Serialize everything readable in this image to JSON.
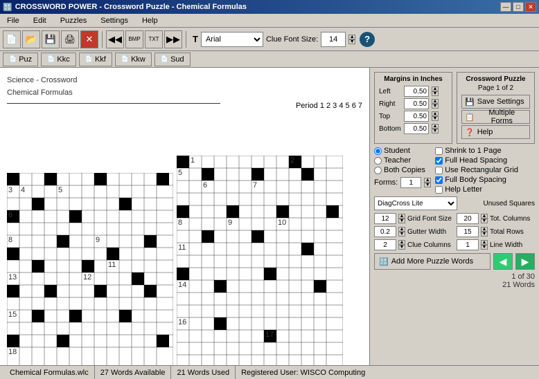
{
  "window": {
    "title": "CROSSWORD POWER - Crossword Puzzle - Chemical Formulas",
    "icon": "🔠"
  },
  "titlebar": {
    "controls": [
      "—",
      "□",
      "✕"
    ]
  },
  "menubar": {
    "items": [
      "File",
      "Edit",
      "Puzzles",
      "Settings",
      "Help"
    ]
  },
  "toolbar": {
    "font_label": "T",
    "font_value": "Arial",
    "clue_font_label": "Clue Font Size:",
    "clue_font_size": "14",
    "help_label": "?"
  },
  "filetabs": {
    "tabs": [
      "Puz",
      "Kkc",
      "Kkf",
      "Kkw",
      "Sud"
    ]
  },
  "puzzle": {
    "title_line1": "Science - Crossword",
    "title_line2": "Chemical Formulas",
    "period_label": "Period",
    "period_values": "1  2  3  4  5  6  7"
  },
  "right_panel": {
    "margins_title": "Margins in Inches",
    "margins": {
      "left_label": "Left",
      "left_value": "0.50",
      "right_label": "Right",
      "right_value": "0.50",
      "top_label": "Top",
      "top_value": "0.50",
      "bottom_label": "Bottom",
      "bottom_value": "0.50"
    },
    "puzzle_info_title": "Crossword Puzzle",
    "puzzle_info_page": "Page 1 of 2",
    "save_settings_label": "Save Settings",
    "multiple_forms_label": "Multiple Forms",
    "help_label": "Help",
    "radio_options": [
      "Student",
      "Teacher",
      "Both Copies"
    ],
    "forms_label": "Forms:",
    "forms_value": "1",
    "checkboxes": {
      "shrink_label": "Shrink to 1 Page",
      "full_head_label": "Full Head Spacing",
      "rectangular_label": "Use Rectangular Grid",
      "full_body_label": "Full Body Spacing",
      "help_letter_label": "Help Letter"
    },
    "shrink_checked": false,
    "full_head_checked": true,
    "rectangular_checked": false,
    "full_body_checked": true,
    "font_style_value": "DiagCross Lite",
    "unused_squares_label": "Unused Squares",
    "grid_font_label": "Grid Font Size",
    "grid_font_value": "12",
    "tot_columns_label": "Tot. Columns",
    "tot_columns_value": "20",
    "gutter_label": "Gutter Width",
    "gutter_value": "0.2",
    "total_rows_label": "Total Rows",
    "total_rows_value": "15",
    "clue_columns_label": "Clue Columns",
    "clue_columns_value": "2",
    "line_width_label": "Line Width",
    "line_width_value": "1",
    "add_words_label": "Add More Puzzle Words",
    "nav_back": "◀",
    "nav_fwd": "▶",
    "page_info_1": "1 of 30",
    "page_info_2": "21 Words"
  },
  "statusbar": {
    "file": "Chemical Formulas.wlc",
    "words_available": "27 Words Available",
    "words_used": "21 Words Used",
    "registered": "Registered User:  WISCO Computing"
  }
}
